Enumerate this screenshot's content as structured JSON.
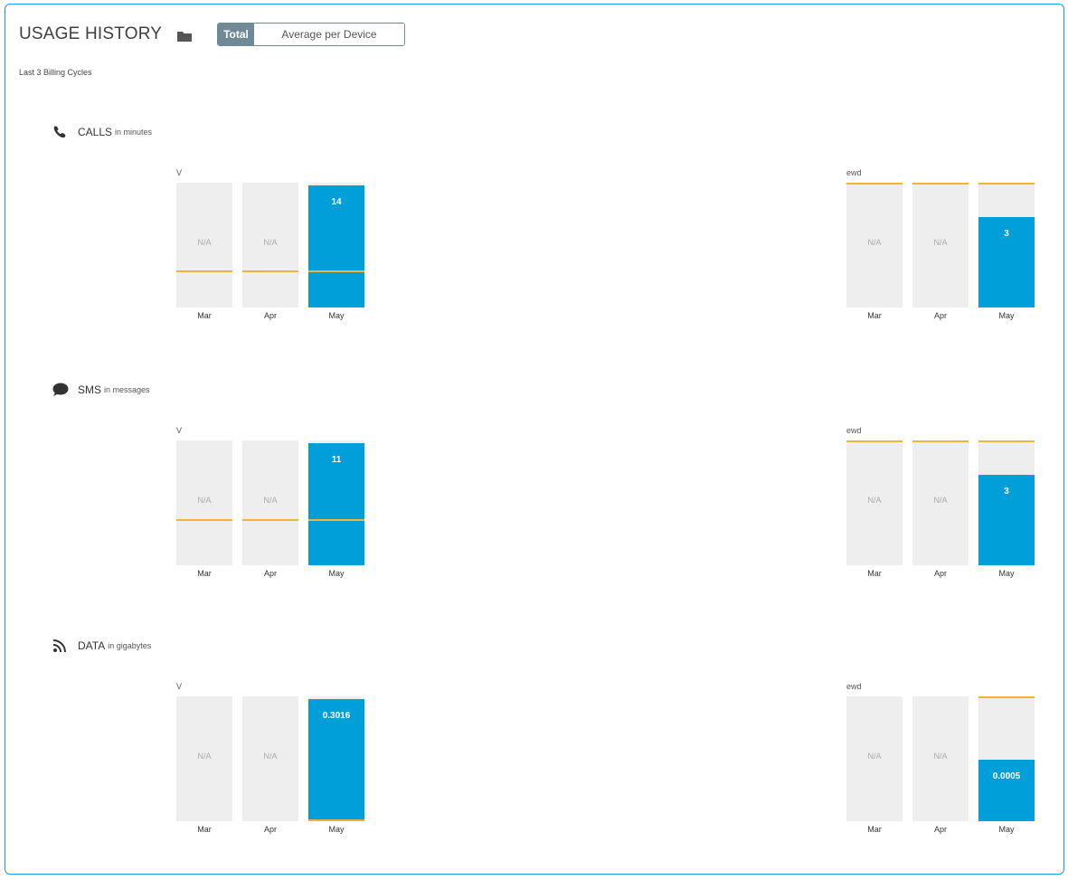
{
  "header": {
    "title": "USAGE HISTORY",
    "toggle": {
      "total": "Total",
      "average": "Average per Device"
    },
    "subtitle": "Last 3 Billing Cycles"
  },
  "colors": {
    "accent": "#009fd9",
    "limit": "#f2b33d",
    "empty": "#eeeeee",
    "frame": "#1a9bd7"
  },
  "sections": [
    {
      "name": "CALLS",
      "unit": "in minutes",
      "icon": "phone-icon",
      "groups": [
        {
          "label": "V",
          "bars": [
            {
              "month": "Mar",
              "value": "N/A",
              "fill": 0,
              "limit": 0.29
            },
            {
              "month": "Apr",
              "value": "N/A",
              "fill": 0,
              "limit": 0.29
            },
            {
              "month": "May",
              "value": "14",
              "fill": 1.0,
              "limit": 0.29
            }
          ]
        },
        {
          "label": "ewd",
          "bars": [
            {
              "month": "Mar",
              "value": "N/A",
              "fill": 0,
              "limit": 1.0
            },
            {
              "month": "Apr",
              "value": "N/A",
              "fill": 0,
              "limit": 1.0
            },
            {
              "month": "May",
              "value": "3",
              "fill": 0.74,
              "limit": 1.0
            }
          ]
        }
      ]
    },
    {
      "name": "SMS",
      "unit": "in messages",
      "icon": "chat-bubble-icon",
      "groups": [
        {
          "label": "V",
          "bars": [
            {
              "month": "Mar",
              "value": "N/A",
              "fill": 0,
              "limit": 0.36
            },
            {
              "month": "Apr",
              "value": "N/A",
              "fill": 0,
              "limit": 0.36
            },
            {
              "month": "May",
              "value": "11",
              "fill": 1.0,
              "limit": 0.36
            }
          ]
        },
        {
          "label": "ewd",
          "bars": [
            {
              "month": "Mar",
              "value": "N/A",
              "fill": 0,
              "limit": 1.0
            },
            {
              "month": "Apr",
              "value": "N/A",
              "fill": 0,
              "limit": 1.0
            },
            {
              "month": "May",
              "value": "3",
              "fill": 0.74,
              "limit": 1.0
            }
          ]
        }
      ]
    },
    {
      "name": "DATA",
      "unit": "in gigabytes",
      "icon": "rss-feed-icon",
      "groups": [
        {
          "label": "V",
          "bars": [
            {
              "month": "Mar",
              "value": "N/A",
              "fill": 0,
              "limit": -1
            },
            {
              "month": "Apr",
              "value": "N/A",
              "fill": 0,
              "limit": -1
            },
            {
              "month": "May",
              "value": "0.3016",
              "fill": 1.0,
              "limit": 0.0
            }
          ]
        },
        {
          "label": "ewd",
          "bars": [
            {
              "month": "Mar",
              "value": "N/A",
              "fill": 0,
              "limit": -1
            },
            {
              "month": "Apr",
              "value": "N/A",
              "fill": 0,
              "limit": -1
            },
            {
              "month": "May",
              "value": "0.0005",
              "fill": 0.5,
              "limit": 1.0
            }
          ]
        }
      ]
    }
  ]
}
